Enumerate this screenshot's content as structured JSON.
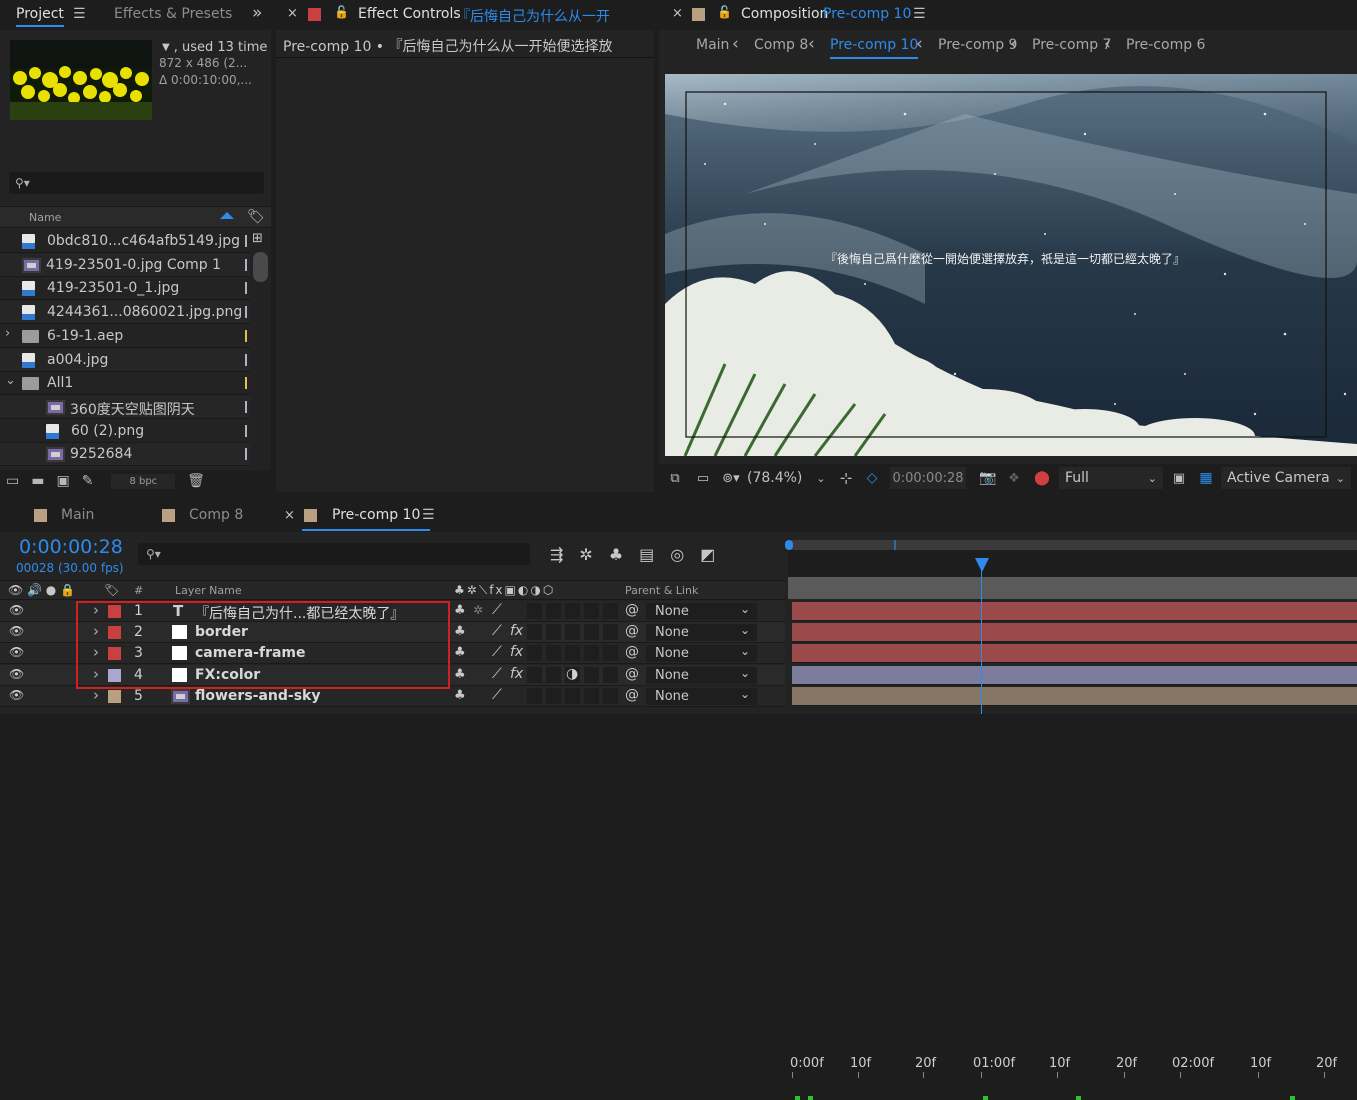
{
  "project_panel": {
    "tabs": [
      "Project",
      "Effects & Presets"
    ],
    "menu_icon": "hamburger-icon",
    "expand_icon": "double-chevron-right-icon",
    "preview_info": {
      "used": ", used 13 time",
      "dimensions": "872 x 486  (2...",
      "duration": "Δ 0:00:10:00,..."
    },
    "search_placeholder": "",
    "column_name": "Name",
    "items": [
      {
        "name": "0bdc810...c464afb5149.jpg",
        "type": "image",
        "color": "#b0b0c8",
        "indent": 0
      },
      {
        "name": "419-23501-0.jpg Comp 1",
        "type": "comp",
        "color": "#b0b0c8",
        "indent": 0
      },
      {
        "name": "419-23501-0_1.jpg",
        "type": "image",
        "color": "#b0b0c8",
        "indent": 0
      },
      {
        "name": "4244361...0860021.jpg.png",
        "type": "image",
        "color": "#b0b0c8",
        "indent": 0
      },
      {
        "name": "6-19-1.aep",
        "type": "folder",
        "color": "#e0c050",
        "indent": 0
      },
      {
        "name": "a004.jpg",
        "type": "image",
        "color": "#b0b0c8",
        "indent": 0
      },
      {
        "name": "All1",
        "type": "folder-open",
        "color": "#e0c050",
        "indent": 0
      },
      {
        "name": "360度天空贴图阴天",
        "type": "comp",
        "color": "#b0b0c8",
        "indent": 1
      },
      {
        "name": "60 (2).png",
        "type": "image",
        "color": "#b0b0c8",
        "indent": 1
      },
      {
        "name": "9252684",
        "type": "comp",
        "color": "#b0b0c8",
        "indent": 1
      }
    ],
    "bpc": "8 bpc"
  },
  "effect_controls": {
    "tab_title": "Effect Controls",
    "tab_layer": "『后悔自己为什么从一开",
    "header": "Pre-comp 10 • 『后悔自己为什么从一开始便选择放"
  },
  "composition": {
    "tab_title": "Composition",
    "tab_comp": "Pre-comp 10",
    "breadcrumbs": [
      "Main",
      "Comp 8",
      "Pre-comp 10",
      "Pre-comp 9",
      "Pre-comp 7",
      "Pre-comp 6"
    ],
    "active_breadcrumb": "Pre-comp 10",
    "subtitle": "『後悔自己爲什麼從一開始便選擇放弃，祇是這一切都已經太晚了』",
    "zoom": "(78.4%)",
    "timecode": "0:00:00:28",
    "resolution": "Full",
    "camera": "Active Camera"
  },
  "timeline": {
    "tabs": [
      "Main",
      "Comp 8",
      "Pre-comp 10"
    ],
    "active_tab": "Pre-comp 10",
    "timecode": "0:00:00:28",
    "frame_info": "00028 (30.00 fps)",
    "search_placeholder": "",
    "col_hash": "#",
    "col_layer_name": "Layer Name",
    "col_parent": "Parent & Link",
    "ruler": [
      "0:00f",
      "10f",
      "20f",
      "01:00f",
      "10f",
      "20f",
      "02:00f",
      "10f",
      "20f"
    ],
    "layers": [
      {
        "num": "1",
        "name": "『后悔自己为什...都已经太晚了』",
        "type": "text",
        "label_color": "#c84040",
        "parent": "None",
        "bar_color": "#9a4a4a"
      },
      {
        "num": "2",
        "name": "border",
        "type": "solid",
        "label_color": "#c84040",
        "parent": "None",
        "bar_color": "#9a4a4a"
      },
      {
        "num": "3",
        "name": "camera-frame",
        "type": "solid",
        "label_color": "#c84040",
        "parent": "None",
        "bar_color": "#9a4a4a"
      },
      {
        "num": "4",
        "name": "FX:color",
        "type": "solid",
        "label_color": "#a8a8d0",
        "parent": "None",
        "bar_color": "#7c7c9c"
      },
      {
        "num": "5",
        "name": "flowers-and-sky",
        "type": "comp",
        "label_color": "#b8a080",
        "parent": "None",
        "bar_color": "#847663"
      }
    ]
  },
  "colors": {
    "accent": "#2d8ceb",
    "highlight_box": "#d02020"
  }
}
